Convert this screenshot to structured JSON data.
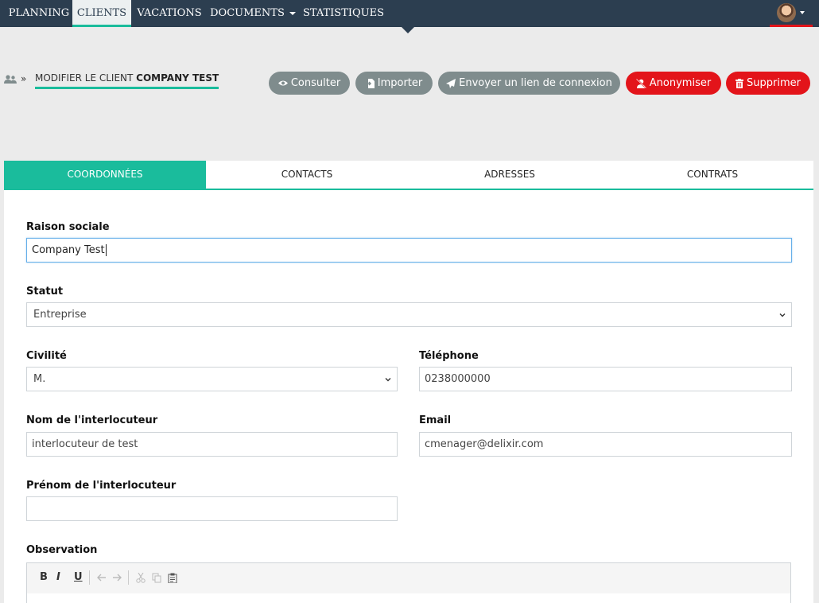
{
  "nav": {
    "items": [
      {
        "label": "PLANNING"
      },
      {
        "label": "CLIENTS",
        "active": true
      },
      {
        "label": "VACATIONS"
      },
      {
        "label": "DOCUMENTS",
        "dropdown": true
      },
      {
        "label": "STATISTIQUES"
      }
    ],
    "accent": "#1abc9c",
    "bg": "#2c3e50"
  },
  "header": {
    "breadcrumb_sep": "»",
    "title_prefix": "MODIFIER LE CLIENT",
    "title_name": "COMPANY TEST"
  },
  "actions": {
    "consult": "Consulter",
    "import": "Importer",
    "send_link": "Envoyer un lien de connexion",
    "anonymize": "Anonymiser",
    "delete": "Supprimer"
  },
  "tabs": [
    "COORDONNÉES",
    "CONTACTS",
    "ADRESSES",
    "CONTRATS"
  ],
  "form": {
    "raison_sociale": {
      "label": "Raison sociale",
      "value": "Company Test"
    },
    "statut": {
      "label": "Statut",
      "value": "Entreprise"
    },
    "civilite": {
      "label": "Civilité",
      "value": "M."
    },
    "telephone": {
      "label": "Téléphone",
      "value": "0238000000"
    },
    "nom": {
      "label": "Nom de l'interlocuteur",
      "value": "interlocuteur de test"
    },
    "email": {
      "label": "Email",
      "value": "cmenager@delixir.com"
    },
    "prenom": {
      "label": "Prénom de l'interlocuteur",
      "value": ""
    },
    "observation": {
      "label": "Observation"
    }
  },
  "editor": {
    "bold": "B",
    "italic": "I",
    "underline": "U"
  }
}
